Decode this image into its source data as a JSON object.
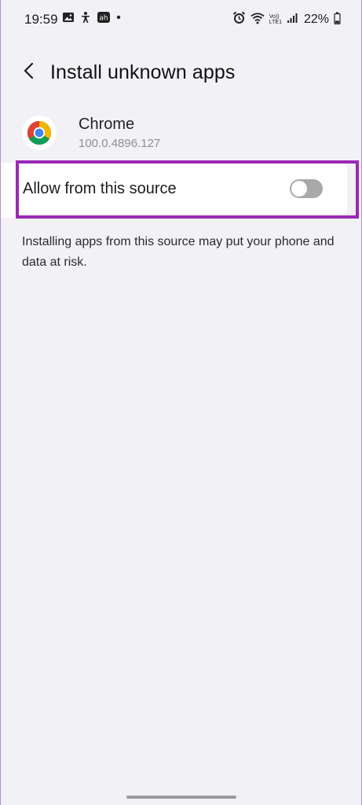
{
  "status_bar": {
    "time": "19:59",
    "battery": "22%",
    "left_icons": [
      "image-icon",
      "accessibility-icon",
      "app-notification-icon",
      "dot-icon"
    ],
    "right_icons": [
      "alarm-icon",
      "wifi-icon",
      "volte-lte-icon",
      "signal-icon",
      "battery-icon"
    ],
    "volte_top": "Vo))",
    "volte_bottom": "LTE1"
  },
  "app_bar": {
    "title": "Install unknown apps",
    "back_icon": "chevron-left-icon"
  },
  "app": {
    "name": "Chrome",
    "version": "100.0.4896.127",
    "icon": "chrome-icon"
  },
  "setting": {
    "label": "Allow from this source",
    "enabled": false
  },
  "warning": {
    "text": "Installing apps from this source may put your phone and data at risk."
  },
  "colors": {
    "background": "#f2f1f6",
    "card": "#ffffff",
    "highlight": "#9a28b4",
    "toggle_off": "#a9a9a9"
  }
}
